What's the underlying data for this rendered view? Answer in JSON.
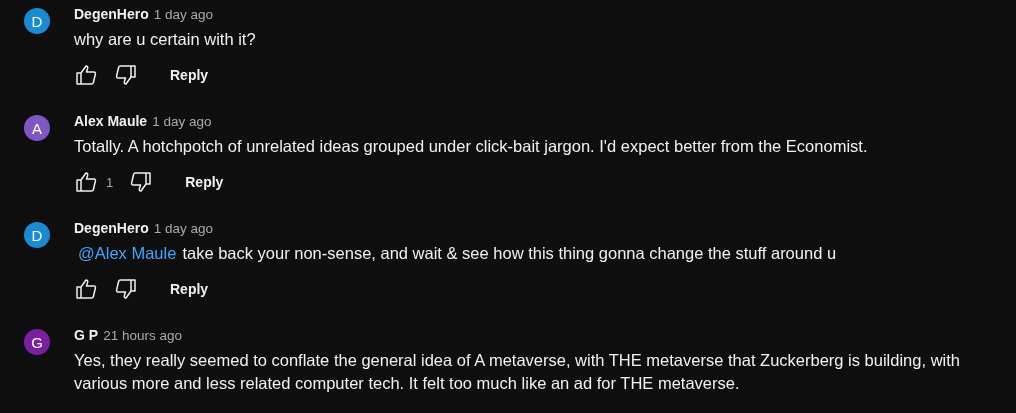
{
  "comments": [
    {
      "initial": "D",
      "color": "#1a8ad4",
      "author": "DegenHero",
      "time": "1 day ago",
      "text": "why are u certain with it?",
      "reply": "Reply"
    },
    {
      "initial": "A",
      "color": "#7e57c2",
      "author": "Alex Maule",
      "time": "1 day ago",
      "text": "Totally. A hotchpotch of unrelated ideas grouped under click-bait jargon. I'd expect better from the Economist.",
      "likes": "1",
      "reply": "Reply"
    },
    {
      "initial": "D",
      "color": "#1a8ad4",
      "author": "DegenHero",
      "time": "1 day ago",
      "mention": "@Alex Maule",
      "text": "take back your non-sense, and wait & see how this thing gonna change the stuff around u",
      "reply": "Reply"
    },
    {
      "initial": "G",
      "color": "#7b1fa2",
      "author": "G P",
      "time": "21 hours ago",
      "text": "Yes, they really seemed to conflate the general idea of A metaverse, with THE metaverse that Zuckerberg is building, with various more and less related computer tech. It felt too much like an ad for THE metaverse."
    }
  ]
}
